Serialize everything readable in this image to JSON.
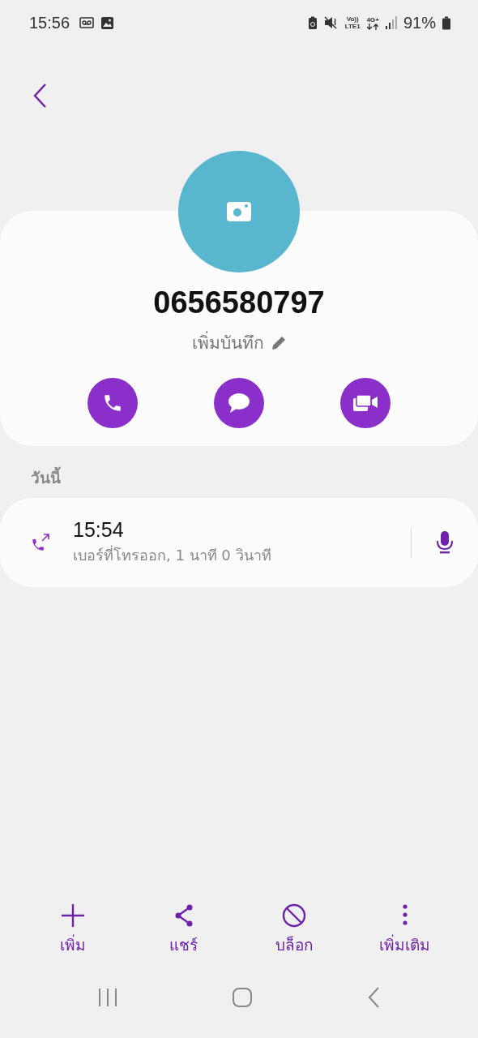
{
  "status_bar": {
    "time": "15:56",
    "volte": "Vo))",
    "lte": "LTE1",
    "network": "4G+",
    "battery": "91%"
  },
  "contact": {
    "number": "0656580797",
    "note": "เพิ่มบันทึก",
    "actions": [
      {
        "kind": "call"
      },
      {
        "kind": "message"
      },
      {
        "kind": "video"
      }
    ]
  },
  "section": "วันนี้",
  "calls": [
    {
      "kind": "outgoing",
      "time": "15:54",
      "detail": "เบอร์ที่โทรออก, 1 นาที 0 วินาที"
    }
  ],
  "bottom_actions": [
    {
      "kind": "add",
      "label": "เพิ่ม"
    },
    {
      "kind": "share",
      "label": "แชร์"
    },
    {
      "kind": "block",
      "label": "บล็อก"
    },
    {
      "kind": "more",
      "label": "เพิ่มเติม"
    }
  ]
}
